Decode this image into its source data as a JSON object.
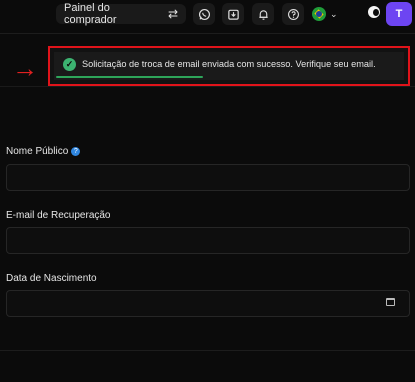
{
  "header": {
    "buyer_panel_label": "Painel do comprador",
    "icons": [
      "swap-icon",
      "whatsapp-icon",
      "download-box-icon",
      "bell-icon",
      "help-icon",
      "brazil-flag-icon",
      "chevron-down-icon",
      "theme-toggle-icon"
    ],
    "avatar_initial": "T",
    "avatar_color": "#6d45f2"
  },
  "toast": {
    "message": "Solicitação de troca de email enviada com sucesso. Verifique seu email.",
    "progress": 0.42,
    "highlight_color": "#e0131a",
    "success_color": "#3cb371"
  },
  "form": {
    "public_name_label": "Nome Público",
    "recovery_email_label": "E-mail de Recuperação",
    "birth_date_label": "Data de Nascimento"
  }
}
